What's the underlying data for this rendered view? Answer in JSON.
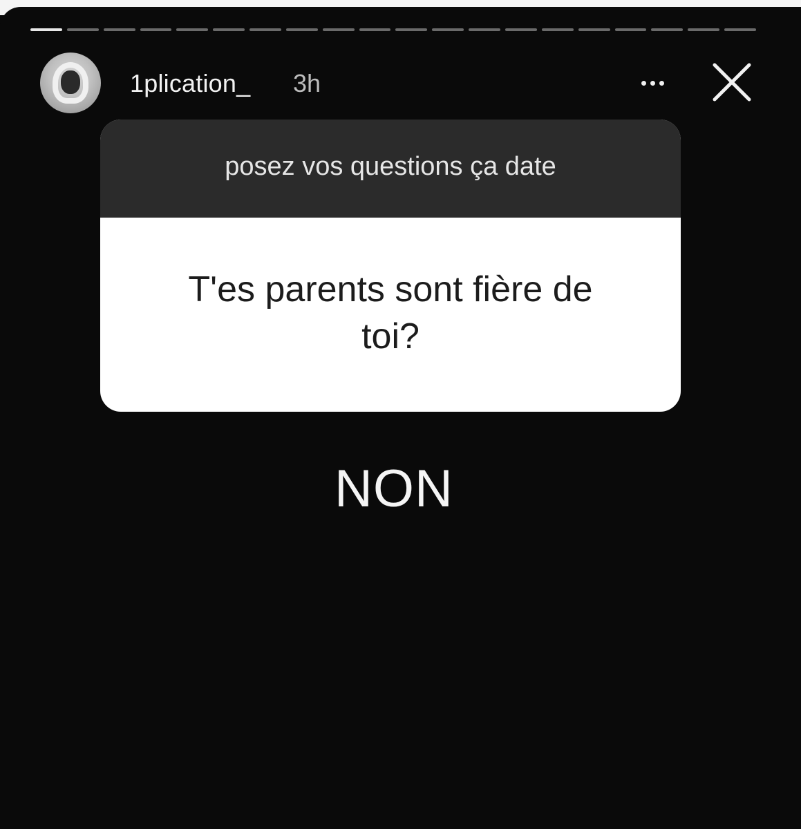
{
  "story": {
    "progress_segments_total": 20,
    "progress_segments_done": 1,
    "header": {
      "username": "1plication_",
      "time_ago": "3h",
      "more_icon": "more-horizontal-icon",
      "close_icon": "close-icon"
    },
    "question_sticker": {
      "prompt": "posez vos questions ça date",
      "question": "T'es parents sont fière de toi?"
    },
    "answer_text": "NON"
  },
  "colors": {
    "background": "#0a0a0a",
    "sticker_header": "#2b2b2b",
    "sticker_body": "#ffffff",
    "progress_done": "#e8e8e8",
    "progress_pending": "#6a6a6a"
  }
}
